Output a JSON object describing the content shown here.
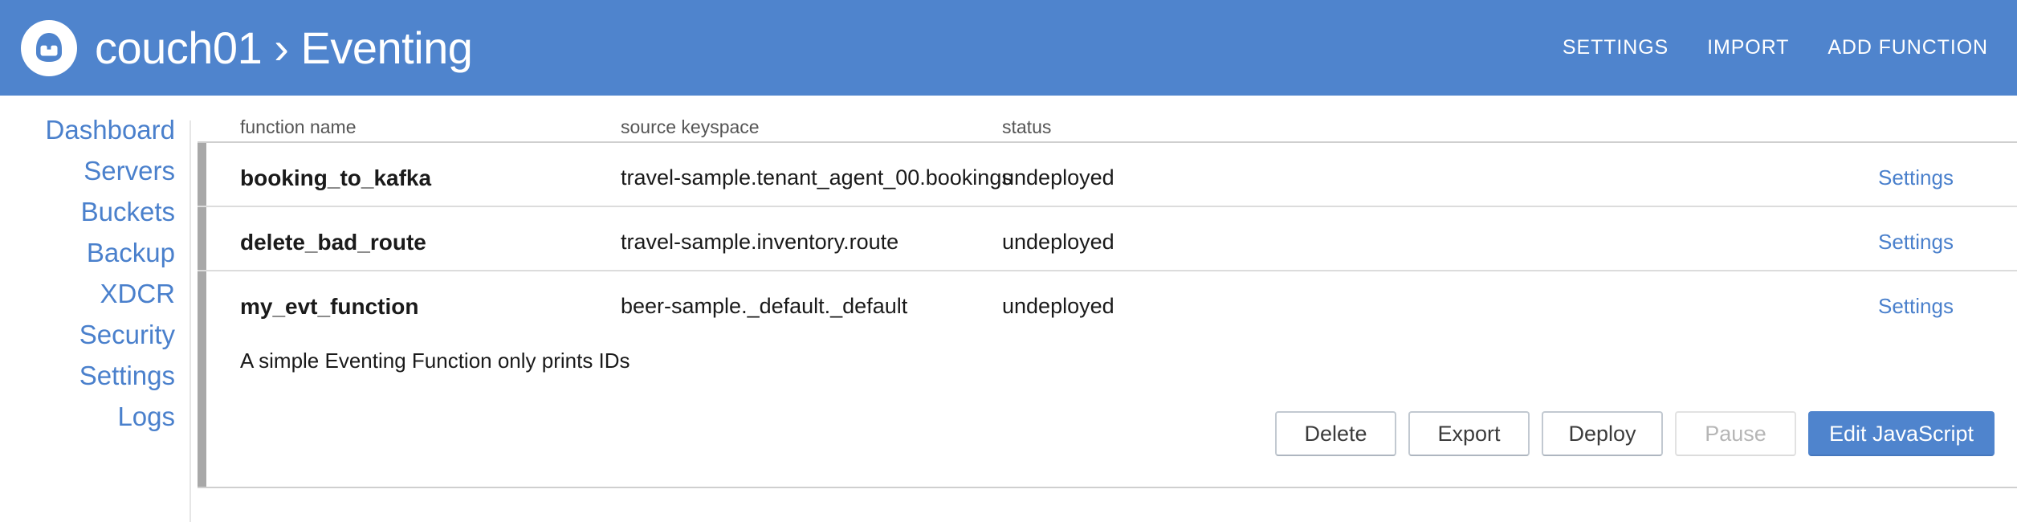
{
  "header": {
    "logo_icon": "couchbase-logo-icon",
    "cluster": "couch01",
    "separator": "›",
    "section": "Eventing",
    "title": "couch01 › Eventing",
    "brand_color": "#4f84cd",
    "nav": [
      {
        "label": "SETTINGS",
        "name": "header-nav-settings"
      },
      {
        "label": "IMPORT",
        "name": "header-nav-import"
      },
      {
        "label": "ADD FUNCTION",
        "name": "header-nav-add-function"
      }
    ]
  },
  "sidebar": {
    "link_color": "#4a80cc",
    "items": [
      {
        "label": "Dashboard"
      },
      {
        "label": "Servers"
      },
      {
        "label": "Buckets"
      },
      {
        "label": "Backup"
      },
      {
        "label": "XDCR"
      },
      {
        "label": "Security"
      },
      {
        "label": "Settings"
      },
      {
        "label": "Logs"
      }
    ]
  },
  "main": {
    "columns": {
      "function_name": "function name",
      "source_keyspace": "source keyspace",
      "status": "status"
    },
    "row_settings_label": "Settings",
    "rows": [
      {
        "function_name": "booking_to_kafka",
        "source_keyspace": "travel-sample.tenant_agent_00.bookings",
        "status": "undeployed",
        "settings_label": "Settings",
        "expanded": false,
        "description": ""
      },
      {
        "function_name": "delete_bad_route",
        "source_keyspace": "travel-sample.inventory.route",
        "status": "undeployed",
        "settings_label": "Settings",
        "expanded": false,
        "description": ""
      },
      {
        "function_name": "my_evt_function",
        "source_keyspace": "beer-sample._default._default",
        "status": "undeployed",
        "settings_label": "Settings",
        "expanded": true,
        "description": "A simple Eventing Function only prints IDs"
      }
    ],
    "actions": [
      {
        "label": "Delete",
        "name": "delete-button",
        "state": "enabled"
      },
      {
        "label": "Export",
        "name": "export-button",
        "state": "enabled"
      },
      {
        "label": "Deploy",
        "name": "deploy-button",
        "state": "enabled"
      },
      {
        "label": "Pause",
        "name": "pause-button",
        "state": "disabled"
      },
      {
        "label": "Edit JavaScript",
        "name": "edit-javascript-button",
        "state": "primary"
      }
    ]
  }
}
